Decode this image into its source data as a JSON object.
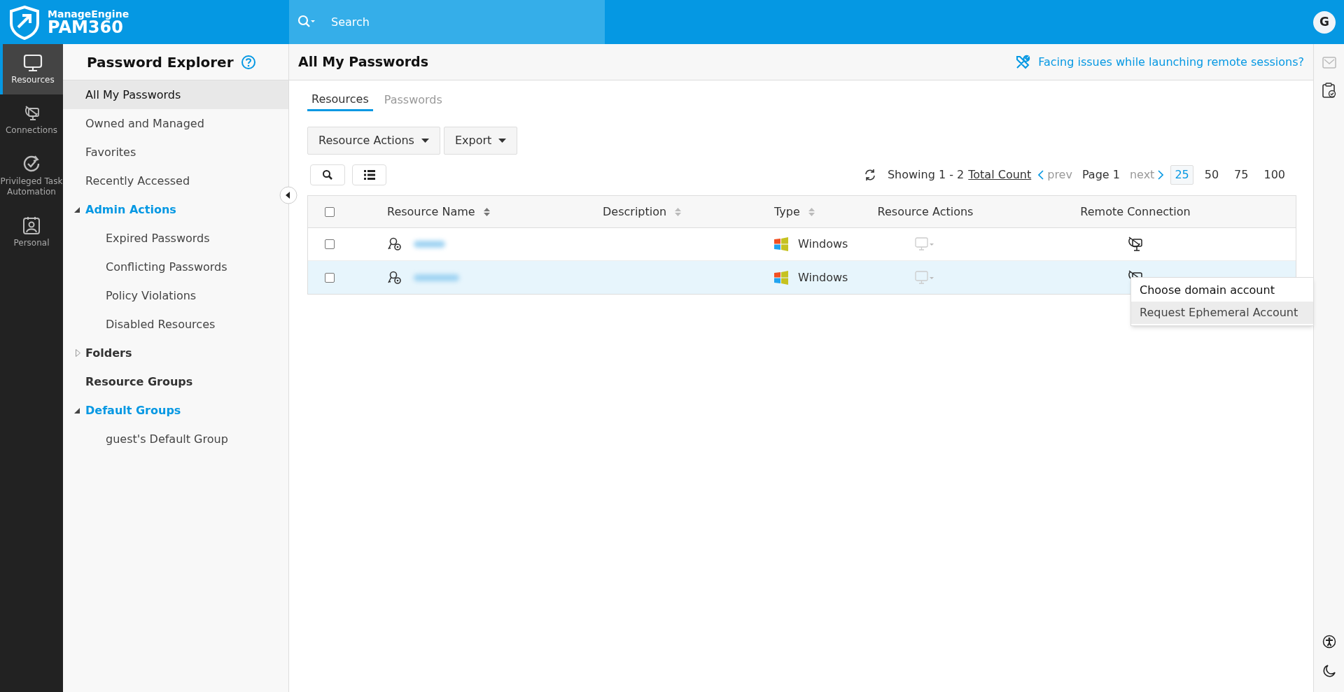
{
  "brand": {
    "company": "ManageEngine",
    "product": "PAM360"
  },
  "search": {
    "placeholder": "Search"
  },
  "user": {
    "initial": "G"
  },
  "rail": [
    {
      "kind": "monitor",
      "label": "Resources",
      "selected": true
    },
    {
      "kind": "connections",
      "label": "Connections",
      "selected": false
    },
    {
      "kind": "task",
      "label": "Privileged Task Automation",
      "selected": false
    },
    {
      "kind": "personal",
      "label": "Personal",
      "selected": false
    }
  ],
  "sidebar": {
    "title": "Password Explorer",
    "items": [
      {
        "label": "All My Passwords",
        "selected": true
      },
      {
        "label": "Owned and Managed",
        "selected": false
      },
      {
        "label": "Favorites",
        "selected": false
      },
      {
        "label": "Recently Accessed",
        "selected": false
      },
      {
        "label": "Admin Actions",
        "kind": "group",
        "expanded": true,
        "selected": false,
        "children": [
          {
            "label": "Expired Passwords",
            "selected": false
          },
          {
            "label": "Conflicting Passwords",
            "selected": false
          },
          {
            "label": "Policy Violations",
            "selected": false
          },
          {
            "label": "Disabled Resources",
            "selected": false
          }
        ]
      },
      {
        "label": "Folders",
        "kind": "group",
        "expanded": false,
        "selected": false
      },
      {
        "label": "Resource Groups",
        "kind": "heading",
        "selected": false
      },
      {
        "label": "Default Groups",
        "kind": "group",
        "expanded": true,
        "selected": false,
        "children": [
          {
            "label": "guest's Default Group",
            "selected": false
          }
        ]
      }
    ]
  },
  "page": {
    "title": "All My Passwords",
    "help_link": "Facing issues while launching remote sessions?"
  },
  "tabs": [
    {
      "label": "Resources",
      "selected": true
    },
    {
      "label": "Passwords",
      "selected": false
    }
  ],
  "action_buttons": [
    "Resource Actions",
    "Export"
  ],
  "pagination": {
    "showing": "Showing 1 - 2",
    "total": "Total Count",
    "prev": "prev",
    "page": "Page 1",
    "next": "next",
    "sizes": [
      {
        "label": "25",
        "selected": true
      },
      {
        "label": "50",
        "selected": false
      },
      {
        "label": "75",
        "selected": false
      },
      {
        "label": "100",
        "selected": false
      }
    ]
  },
  "table": {
    "select_all_checked": false,
    "columns": [
      {
        "label": "Resource Name",
        "sortable": true
      },
      {
        "label": "Description",
        "sortable": true
      },
      {
        "label": "Type",
        "sortable": true
      },
      {
        "label": "Resource Actions",
        "sortable": false
      },
      {
        "label": "Remote Connection",
        "sortable": false
      }
    ],
    "rows": [
      {
        "checked": false,
        "selected": false,
        "type": "Windows"
      },
      {
        "checked": false,
        "selected": true,
        "type": "Windows"
      }
    ]
  },
  "context_menu": [
    {
      "label": "Choose domain account",
      "selected": false
    },
    {
      "label": "Request Ephemeral Account",
      "selected": true
    }
  ]
}
